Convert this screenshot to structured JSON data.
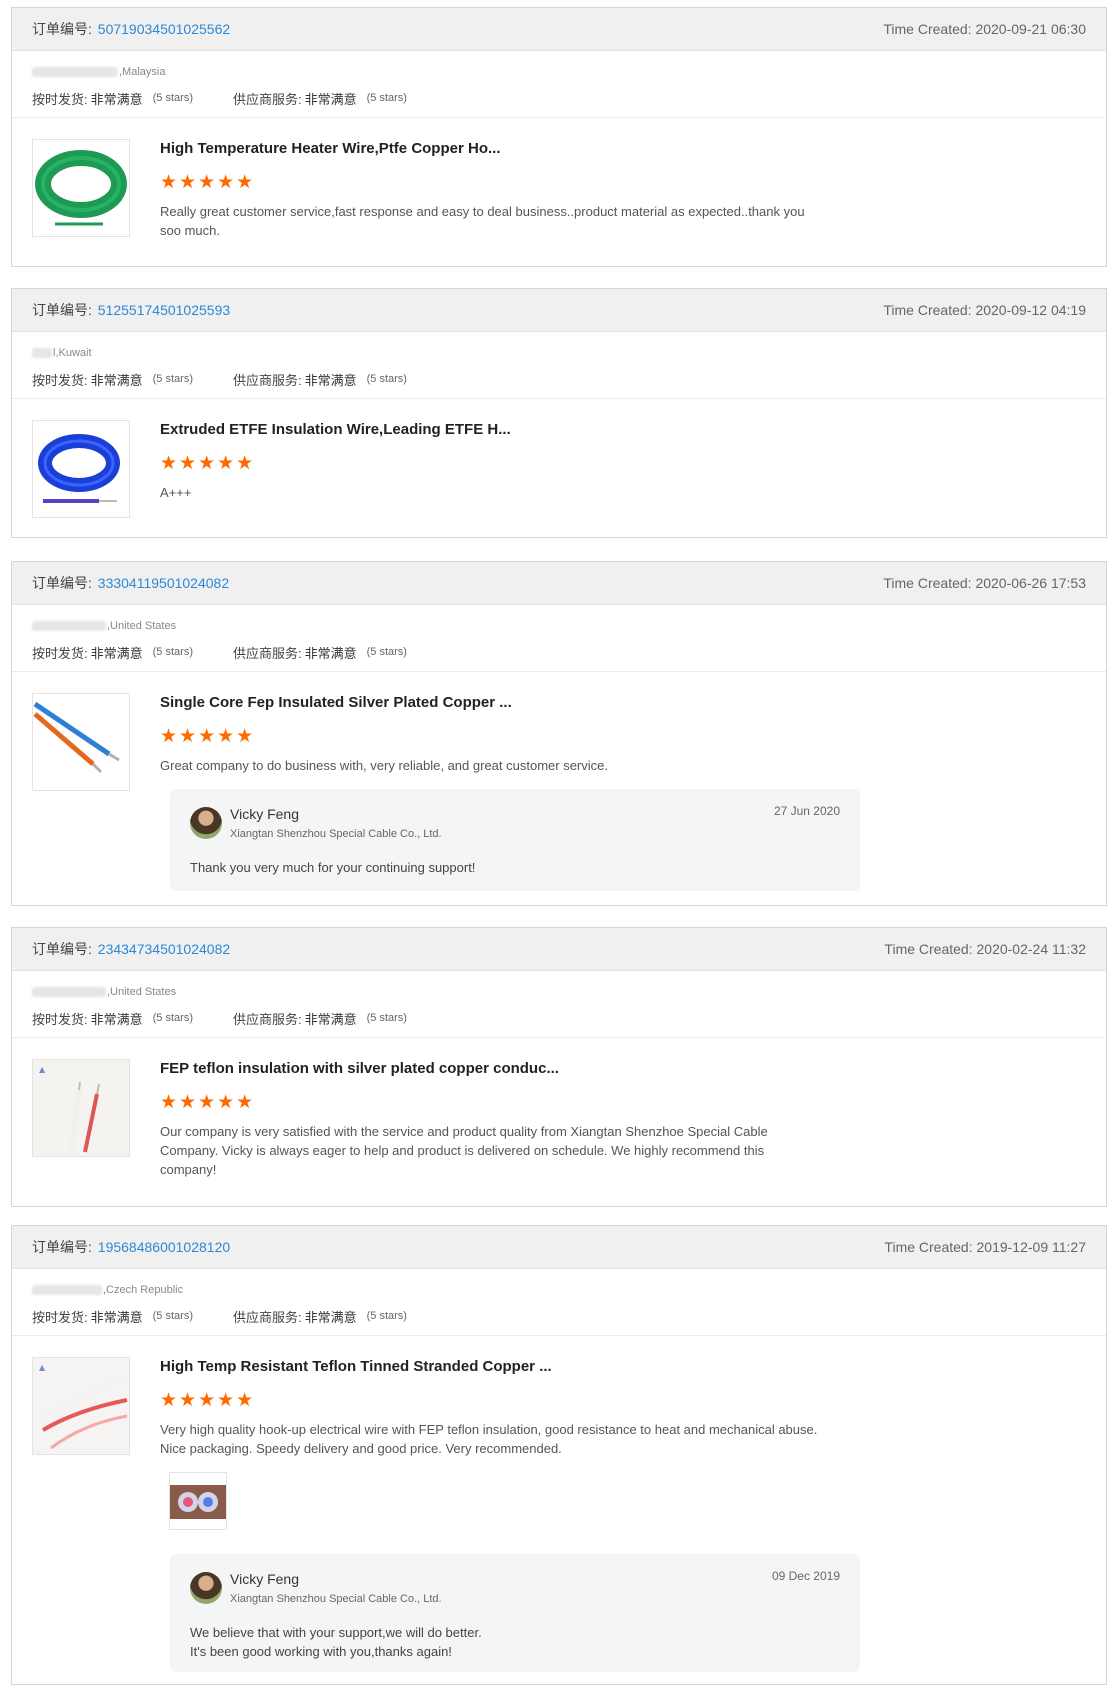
{
  "labels": {
    "order_prefix": "订单编号:",
    "time_prefix": "Time Created:",
    "on_time_label": "按时发货:",
    "service_label": "供应商服务:",
    "satisfied": "非常满意",
    "stars_text": "(5 stars)",
    "star_glyphs": "★★★★★"
  },
  "reviews": [
    {
      "order_no": "50719034501025562",
      "time": "2020-09-21 06:30",
      "country": ",Malaysia",
      "title": "High Temperature Heater Wire,Ptfe Copper Ho...",
      "text": "Really great customer service,fast response and easy to deal business..product material as expected..thank you soo much.",
      "image": "green-wire-coil",
      "wire_color": "#1e9a55"
    },
    {
      "order_no": "51255174501025593",
      "time": "2020-09-12 04:19",
      "country": "l,Kuwait",
      "title": "Extruded ETFE Insulation Wire,Leading ETFE H...",
      "text": "A+++",
      "image": "blue-wire-coil",
      "wire_color": "#1a3fd6"
    },
    {
      "order_no": "33304119501024082",
      "time": "2020-06-26 17:53",
      "country": ",United States",
      "title": "Single Core Fep Insulated Silver Plated Copper ...",
      "text": "Great company to do business with, very reliable, and great customer service.",
      "image": "blue-orange-wires",
      "reply": {
        "name": "Vicky Feng",
        "company": "Xiangtan Shenzhou Special Cable Co., Ltd.",
        "date": "27 Jun 2020",
        "text": "Thank you very much for your continuing support!"
      }
    },
    {
      "order_no": "23434734501024082",
      "time": "2020-02-24 11:32",
      "country": ",United States",
      "title": "FEP teflon insulation with silver plated copper conduc...",
      "text": "Our company is very satisfied with the service and product quality from Xiangtan Shenzhoe Special Cable Company.  Vicky is always eager to help and product is delivered on schedule.  We highly recommend this company!",
      "image": "white-red-wires"
    },
    {
      "order_no": "19568486001028120",
      "time": "2019-12-09 11:27",
      "country": ",Czech Republic",
      "title": "High Temp Resistant Teflon Tinned Stranded Copper ...",
      "text": "Very high quality hook-up electrical wire with FEP teflon insulation, good resistance to heat and mechanical abuse. Nice packaging. Speedy delivery and good price. Very recommended.",
      "image": "white-red-wires-2",
      "photo": "buyer-photo",
      "reply": {
        "name": "Vicky Feng",
        "company": "Xiangtan Shenzhou Special Cable Co., Ltd.",
        "date": "09 Dec 2019",
        "text": "We believe that with your support,we will do better.\nIt's been good working with you,thanks again!"
      }
    }
  ]
}
